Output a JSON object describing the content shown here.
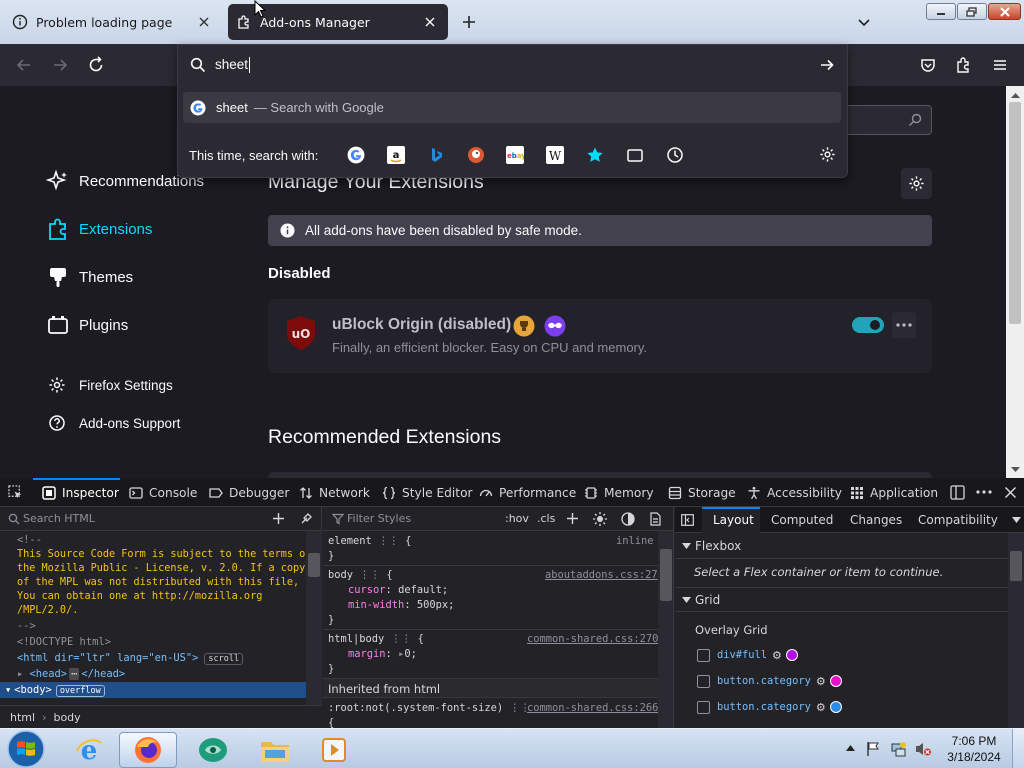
{
  "tabs": [
    {
      "label": "Problem loading page",
      "active": false
    },
    {
      "label": "Add-ons Manager",
      "active": true
    }
  ],
  "urlbar": {
    "value": "sheet",
    "suggestion": "sheet",
    "suggestion_suffix": "— Search with Google",
    "search_with_label": "This time, search with:",
    "engines": [
      "google-icon",
      "amazon-icon",
      "bing-icon",
      "duckduckgo-icon",
      "ebay-icon",
      "wikipedia-icon",
      "bookmarks-star-icon",
      "tabs-icon",
      "history-icon"
    ]
  },
  "sidebar": {
    "items": [
      {
        "label": "Recommendations",
        "icon": "sparkle-icon"
      },
      {
        "label": "Extensions",
        "icon": "puzzle-icon",
        "selected": true
      },
      {
        "label": "Themes",
        "icon": "brush-icon"
      },
      {
        "label": "Plugins",
        "icon": "plugin-icon"
      }
    ],
    "footer": [
      {
        "label": "Firefox Settings",
        "icon": "gear-icon"
      },
      {
        "label": "Add-ons Support",
        "icon": "help-icon"
      }
    ]
  },
  "main": {
    "heading": "Manage Your Extensions",
    "notice": "All add-ons have been disabled by safe mode.",
    "section_disabled": "Disabled",
    "addon": {
      "name": "uBlock Origin (disabled)",
      "description": "Finally, an efficient blocker. Easy on CPU and memory.",
      "enabled": true
    },
    "recommended_heading": "Recommended Extensions"
  },
  "devtools": {
    "tabs": [
      "Inspector",
      "Console",
      "Debugger",
      "Network",
      "Style Editor",
      "Performance",
      "Memory",
      "Storage",
      "Accessibility",
      "Application"
    ],
    "active_tab": "Inspector",
    "search_placeholder": "Search HTML",
    "filter_placeholder": "Filter Styles",
    "hov": ":hov",
    "cls": ".cls",
    "html_lines": [
      "<!--",
      "This Source Code Form is subject to the terms of",
      "the Mozilla Public - License, v. 2.0. If a copy",
      "of the MPL was not distributed with this file, -",
      "You can obtain one at http://mozilla.org",
      "/MPL/2.0/.",
      "-->",
      "<!DOCTYPE html>",
      "<html dir=\"ltr\" lang=\"en-US\">",
      "<head>",
      "</head>",
      "<body>"
    ],
    "badges": {
      "scroll": "scroll",
      "overflow": "overflow"
    },
    "breadcrumb": [
      "html",
      "body"
    ],
    "rules": [
      {
        "selector": "element",
        "source": "inline",
        "props": []
      },
      {
        "selector": "body",
        "source": "aboutaddons.css:27",
        "props": [
          [
            "cursor",
            "default"
          ],
          [
            "min-width",
            "500px"
          ]
        ]
      },
      {
        "selector": "html|body",
        "source": "common-shared.css:270",
        "props": [
          [
            "margin",
            "0"
          ]
        ]
      }
    ],
    "inherited": "Inherited from html",
    "root_rule": {
      "selector": ":root:not(.system-font-size)",
      "source": "common-shared.css:266"
    },
    "layout_tabs": [
      "Layout",
      "Computed",
      "Changes",
      "Compatibility"
    ],
    "flexbox_header": "Flexbox",
    "flexbox_hint": "Select a Flex container or item to continue.",
    "grid_header": "Grid",
    "overlay_grid": "Overlay Grid",
    "grids": [
      {
        "label": "div#full",
        "color": "#b30de6"
      },
      {
        "label": "button.category",
        "color": "#e312c7"
      },
      {
        "label": "button.category",
        "color": "#2b8de8"
      }
    ]
  },
  "taskbar": {
    "time": "7:06 PM",
    "date": "3/18/2024",
    "apps": [
      "ie-icon",
      "firefox-icon",
      "app-icon",
      "explorer-icon",
      "media-icon"
    ]
  }
}
